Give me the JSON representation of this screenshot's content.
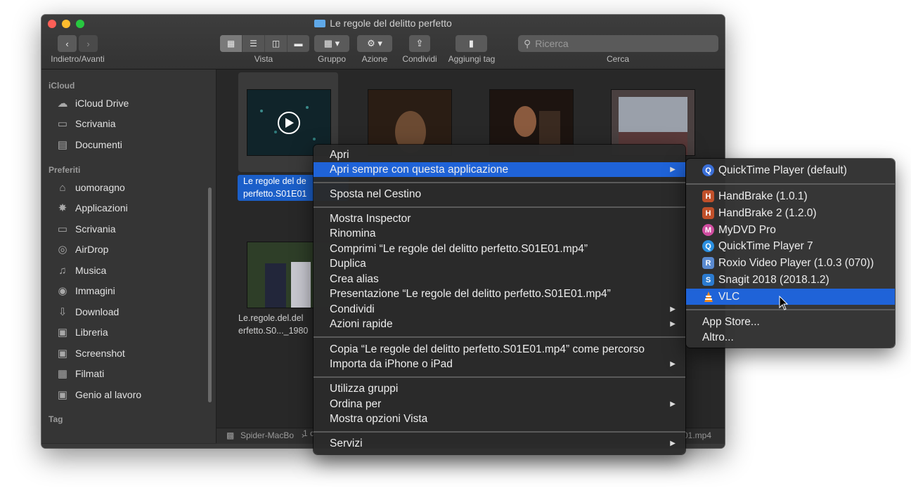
{
  "window": {
    "title": "Le regole del delitto perfetto",
    "toolbar": {
      "nav_label": "Indietro/Avanti",
      "view_label": "Vista",
      "group_label": "Gruppo",
      "action_label": "Azione",
      "share_label": "Condividi",
      "tag_label": "Aggiungi tag",
      "search_label": "Cerca",
      "search_placeholder": "Ricerca"
    }
  },
  "sidebar": {
    "sections": [
      {
        "heading": "iCloud",
        "items": [
          {
            "label": "iCloud Drive",
            "icon": "cloud-icon"
          },
          {
            "label": "Scrivania",
            "icon": "desktop-icon"
          },
          {
            "label": "Documenti",
            "icon": "document-icon"
          }
        ]
      },
      {
        "heading": "Preferiti",
        "items": [
          {
            "label": "uomoragno",
            "icon": "home-icon"
          },
          {
            "label": "Applicazioni",
            "icon": "applications-icon"
          },
          {
            "label": "Scrivania",
            "icon": "desktop-icon"
          },
          {
            "label": "AirDrop",
            "icon": "airdrop-icon"
          },
          {
            "label": "Musica",
            "icon": "music-icon"
          },
          {
            "label": "Immagini",
            "icon": "camera-icon"
          },
          {
            "label": "Download",
            "icon": "download-icon"
          },
          {
            "label": "Libreria",
            "icon": "folder-icon"
          },
          {
            "label": "Screenshot",
            "icon": "folder-icon"
          },
          {
            "label": "Filmati",
            "icon": "film-icon"
          },
          {
            "label": "Genio al lavoro",
            "icon": "folder-icon"
          }
        ]
      },
      {
        "heading": "Tag",
        "items": []
      }
    ]
  },
  "files": {
    "selected_name_line1": "Le regole del de",
    "selected_name_line2": "perfetto.S01E01",
    "second_name_line1": "Le.regole.del.del",
    "second_name_line2": "erfetto.S0..._1980"
  },
  "pathbar": {
    "left": "Spider-MacBo",
    "right": "01.mp4",
    "status": "1 c"
  },
  "context_menu": {
    "items": [
      {
        "label": "Apri",
        "submenu": false
      },
      {
        "label": "Apri sempre con questa applicazione",
        "submenu": true,
        "highlighted": true
      },
      {
        "label": "Sposta nel Cestino",
        "submenu": false
      },
      {
        "label": "Mostra Inspector",
        "submenu": false
      },
      {
        "label": "Rinomina",
        "submenu": false
      },
      {
        "label": "Comprimi “Le regole del delitto perfetto.S01E01.mp4”",
        "submenu": false
      },
      {
        "label": "Duplica",
        "submenu": false
      },
      {
        "label": "Crea alias",
        "submenu": false
      },
      {
        "label": "Presentazione “Le regole del delitto perfetto.S01E01.mp4”",
        "submenu": false
      },
      {
        "label": "Condividi",
        "submenu": true
      },
      {
        "label": "Azioni rapide",
        "submenu": true
      },
      {
        "label": "Copia “Le regole del delitto perfetto.S01E01.mp4” come percorso",
        "submenu": false
      },
      {
        "label": "Importa da iPhone o iPad",
        "submenu": true
      },
      {
        "label": "Utilizza gruppi",
        "submenu": false
      },
      {
        "label": "Ordina per",
        "submenu": true
      },
      {
        "label": "Mostra opzioni Vista",
        "submenu": false
      },
      {
        "label": "Servizi",
        "submenu": true
      }
    ],
    "arrow": "▶"
  },
  "submenu": {
    "apps": [
      {
        "label": "QuickTime Player (default)",
        "icon": "quicktime-icon",
        "color": "#3a6fd8"
      },
      {
        "label": "HandBrake (1.0.1)",
        "icon": "handbrake-icon",
        "color": "#c0502a"
      },
      {
        "label": "HandBrake 2 (1.2.0)",
        "icon": "handbrake-icon",
        "color": "#c0502a"
      },
      {
        "label": "MyDVD Pro",
        "icon": "mydvd-icon",
        "color": "#d04da0"
      },
      {
        "label": "QuickTime Player 7",
        "icon": "quicktime7-icon",
        "color": "#2a8fe0"
      },
      {
        "label": "Roxio Video Player (1.0.3 (070))",
        "icon": "roxio-icon",
        "color": "#5a8ad0"
      },
      {
        "label": "Snagit 2018 (2018.1.2)",
        "icon": "snagit-icon",
        "color": "#2b7bd0"
      },
      {
        "label": "VLC",
        "icon": "vlc-icon",
        "color": "#f08a1c",
        "highlighted": true
      }
    ],
    "extra": [
      {
        "label": "App Store..."
      },
      {
        "label": "Altro..."
      }
    ]
  },
  "colors": {
    "highlight": "#1f63d8",
    "menu_bg": "#2a2a2a"
  }
}
